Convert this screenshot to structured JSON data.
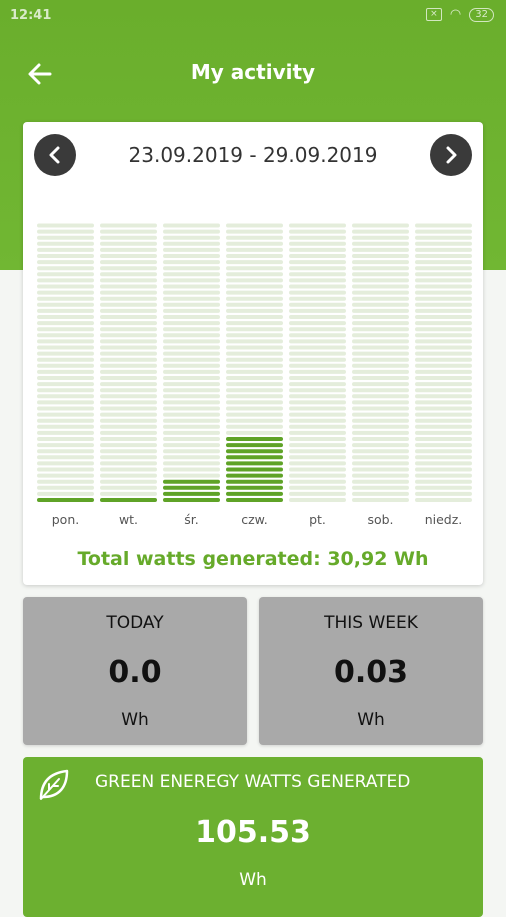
{
  "status_bar": {
    "time": "12:41",
    "battery": "32"
  },
  "header": {
    "title": "My activity"
  },
  "week": {
    "date_range": "23.09.2019 - 29.09.2019"
  },
  "chart_data": {
    "type": "bar",
    "categories": [
      "pon.",
      "wt.",
      "śr.",
      "czw.",
      "pt.",
      "sob.",
      "niedz."
    ],
    "values": [
      1,
      1,
      4,
      11,
      0,
      0,
      0
    ],
    "ylim": [
      0,
      46
    ],
    "colors": {
      "filled": "#5fa327",
      "empty": "#e4eddb"
    }
  },
  "total": "Total watts generated: 30,92 Wh",
  "today": {
    "label": "TODAY",
    "value": "0.0",
    "unit": "Wh"
  },
  "this_week": {
    "label": "THIS WEEK",
    "value": "0.03",
    "unit": "Wh"
  },
  "green": {
    "label": "GREEN ENEREGY WATTS GENERATED",
    "value": "105.53",
    "unit": "Wh",
    "icon": "leaf-icon"
  }
}
